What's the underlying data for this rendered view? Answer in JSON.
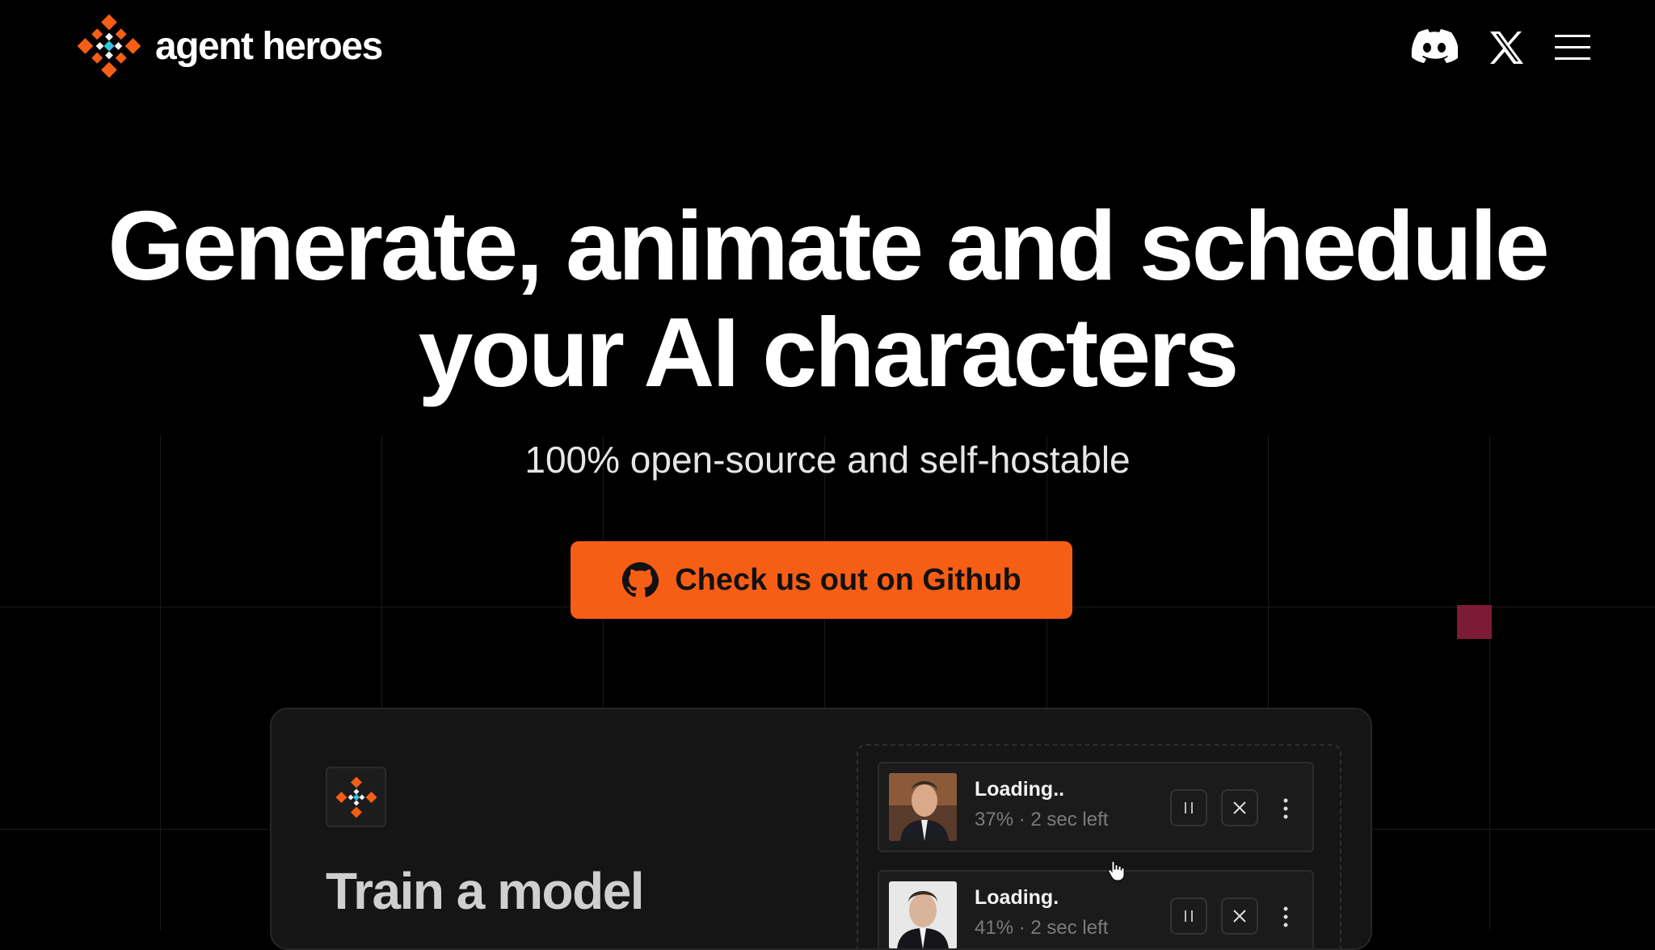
{
  "brand": {
    "name": "agent heroes",
    "logo_icon": "diamond-logo-icon"
  },
  "nav": {
    "discord_icon": "discord-icon",
    "x_icon": "x-icon",
    "menu_icon": "hamburger-menu-icon"
  },
  "hero": {
    "title_line1": "Generate, animate and schedule",
    "title_line2": "your AI characters",
    "subtitle": "100% open-source and self-hostable",
    "cta_label": "Check us out on Github",
    "cta_icon": "github-icon"
  },
  "demo": {
    "title": "Train a model",
    "queue": [
      {
        "title": "Loading..",
        "meta": "37% · 2 sec left",
        "progress_percent": 37
      },
      {
        "title": "Loading.",
        "meta": "41% · 2 sec left",
        "progress_percent": 41
      }
    ]
  },
  "colors": {
    "background": "#000000",
    "cta": "#f65e16",
    "logo_orange": "#f65e16",
    "logo_cyan": "#33c7dd",
    "accent_square": "#7d1a34"
  }
}
